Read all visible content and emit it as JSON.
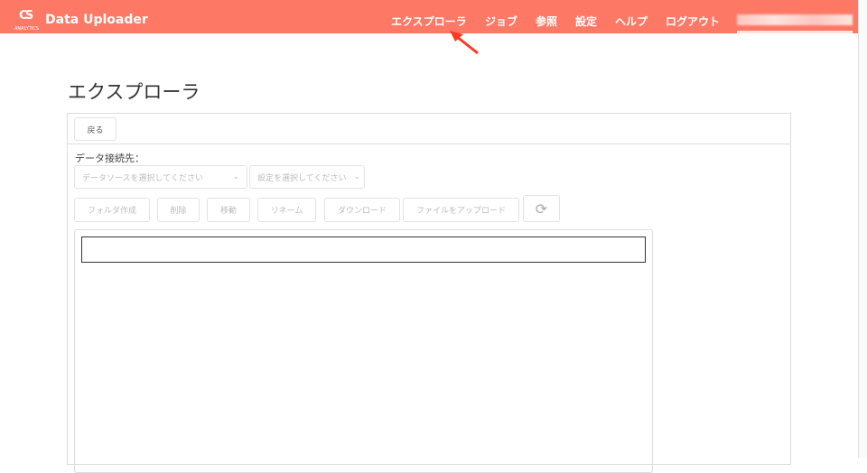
{
  "header": {
    "logo_mark": "CS",
    "logo_sub": "ANALYTICS",
    "app_title": "Data Uploader",
    "nav": [
      "エクスプローラ",
      "ジョブ",
      "参照",
      "設定",
      "ヘルプ",
      "ログアウト"
    ]
  },
  "page": {
    "title": "エクスプローラ"
  },
  "panel": {
    "back_label": "戻る",
    "connection_label": "データ接続先：",
    "datasource_placeholder": "データソースを選択してください",
    "setting_placeholder": "設定を選択してください",
    "actions": [
      "フォルダ作成",
      "削除",
      "移動",
      "リネーム",
      "ダウンロード",
      "ファイルをアップロード"
    ],
    "path_value": ""
  },
  "colors": {
    "header": "#FE7866",
    "annotation_arrow": "#FF3B1F"
  }
}
